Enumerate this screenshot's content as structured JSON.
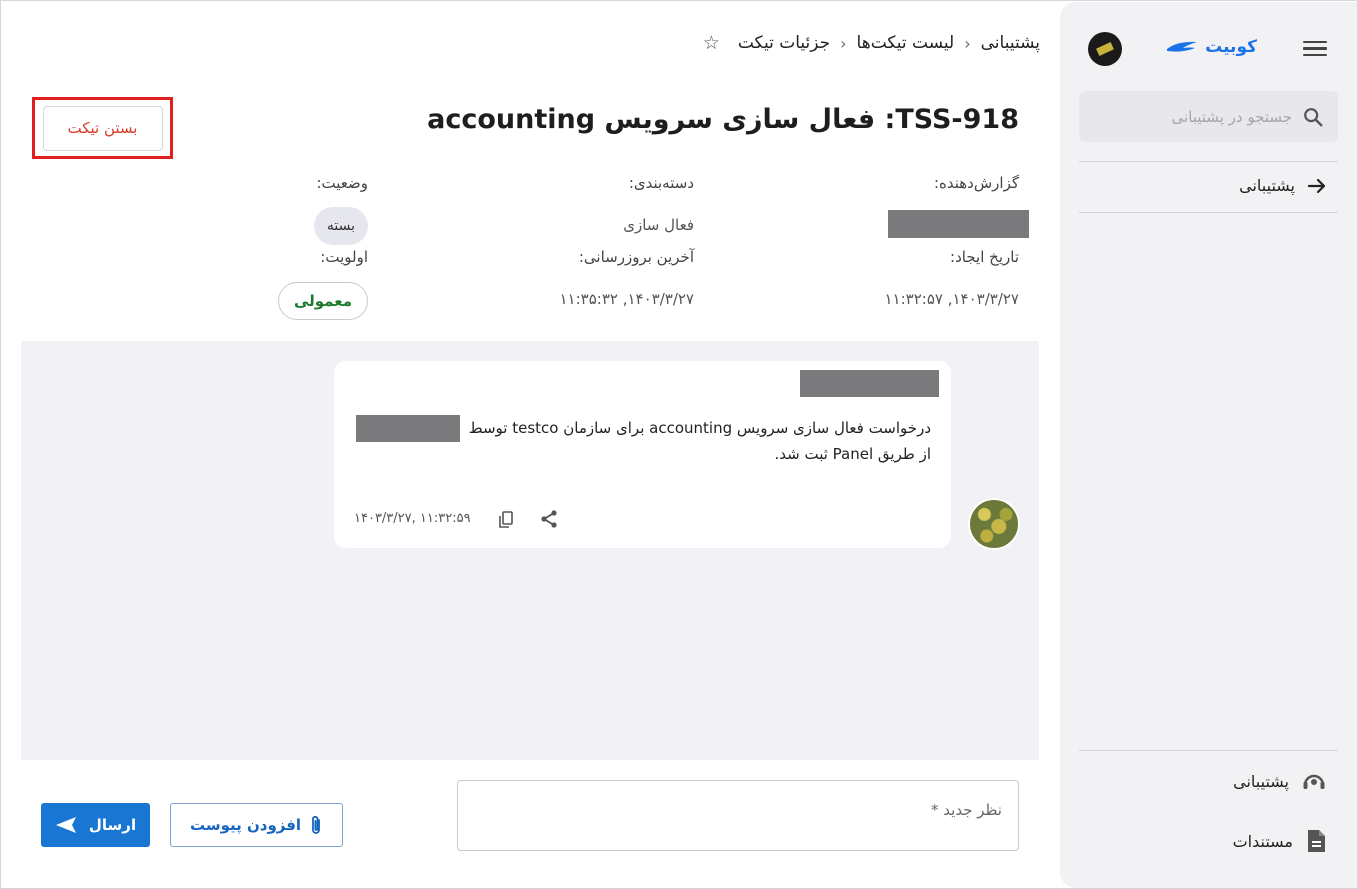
{
  "sidebar": {
    "logo_text": "کوبیت",
    "search_placeholder": "جستجو در پشتیبانی",
    "nav_item": "پشتیبانی",
    "bottom_items": [
      {
        "label": "پشتیبانی",
        "icon": "support-icon"
      },
      {
        "label": "مستندات",
        "icon": "document-icon"
      }
    ]
  },
  "breadcrumb": {
    "items": [
      "پشتیبانی",
      "لیست تیکت‌ها",
      "جزئیات تیکت"
    ]
  },
  "ticket": {
    "title": "TSS-918: فعال سازی سرویس accounting",
    "close_label": "بستن تیکت",
    "fields": {
      "reporter_label": "گزارش‌دهنده:",
      "category_label": "دسته‌بندی:",
      "category_value": "فعال سازی",
      "status_label": "وضعیت:",
      "status_value": "بسته",
      "created_label": "تاریخ ایجاد:",
      "created_value": "۱۴۰۳/۳/۲۷, ۱۱:۳۲:۵۷",
      "updated_label": "آخرین بروزرسانی:",
      "updated_value": "۱۴۰۳/۳/۲۷, ۱۱:۳۵:۳۲",
      "priority_label": "اولویت:",
      "priority_value": "معمولی"
    }
  },
  "message": {
    "text_line1": "درخواست فعال سازی سرویس accounting برای سازمان testco توسط",
    "text_line2": "از طریق Panel ثبت شد.",
    "timestamp": "۱۴۰۳/۳/۲۷, ۱۱:۳۲:۵۹"
  },
  "composer": {
    "placeholder": "نظر جدید *",
    "attach_label": "افزودن پیوست",
    "send_label": "ارسال"
  },
  "colors": {
    "accent": "#1976d2",
    "danger": "#d63a2a",
    "highlight_border": "#e0201d",
    "priority_text": "#1e7a2c"
  }
}
